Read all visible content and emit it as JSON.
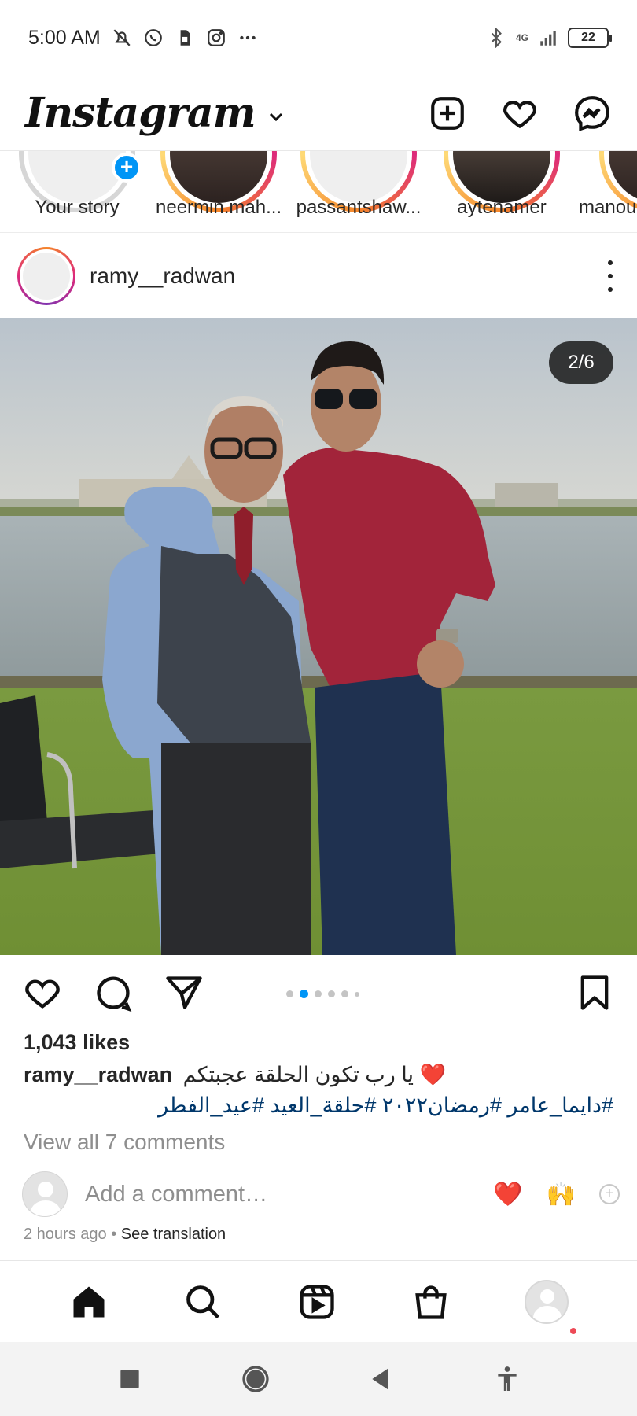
{
  "status_bar": {
    "time": "5:00 AM",
    "battery": "22",
    "network": "4G",
    "icons": [
      "mute-icon",
      "whatsapp-icon",
      "sim-icon",
      "instagram-icon",
      "more-dots-icon",
      "bluetooth-icon",
      "signal-icon",
      "battery-icon"
    ]
  },
  "header": {
    "logo": "Instagram",
    "actions": [
      "new-post-icon",
      "activity-heart-icon",
      "messenger-icon"
    ]
  },
  "stories": [
    {
      "name": "Your story",
      "own": true
    },
    {
      "name": "neermin.mah..."
    },
    {
      "name": "passantshaw..."
    },
    {
      "name": "aytenamer"
    },
    {
      "name": "manou"
    }
  ],
  "post": {
    "username": "ramy__radwan",
    "page_indicator": "2/6",
    "carousel": {
      "total": 6,
      "current": 2
    },
    "likes": "1,043 likes",
    "caption_user": "ramy__radwan",
    "caption_text": "يا رب تكون الحلقة عجبتكم ❤️",
    "hashtags": "#دايما_عامر #رمضان٢٠٢٢ #حلقة_العيد #عيد_الفطر",
    "view_comments": "View all 7 comments",
    "comment_placeholder": "Add a comment…",
    "quick_reactions": [
      "❤️",
      "🙌"
    ],
    "timestamp": "2 hours ago",
    "separator": " • ",
    "translate": "See translation"
  },
  "bottom_nav": [
    "home-icon",
    "search-icon",
    "reels-icon",
    "shop-icon",
    "profile-avatar"
  ],
  "system_nav": [
    "recents-square-icon",
    "home-circle-icon",
    "back-triangle-icon",
    "accessibility-icon"
  ],
  "colors": {
    "accent": "#0095f6",
    "hashtag": "#00376b",
    "muted": "#8e8e8e",
    "like_red": "#ed4956"
  }
}
